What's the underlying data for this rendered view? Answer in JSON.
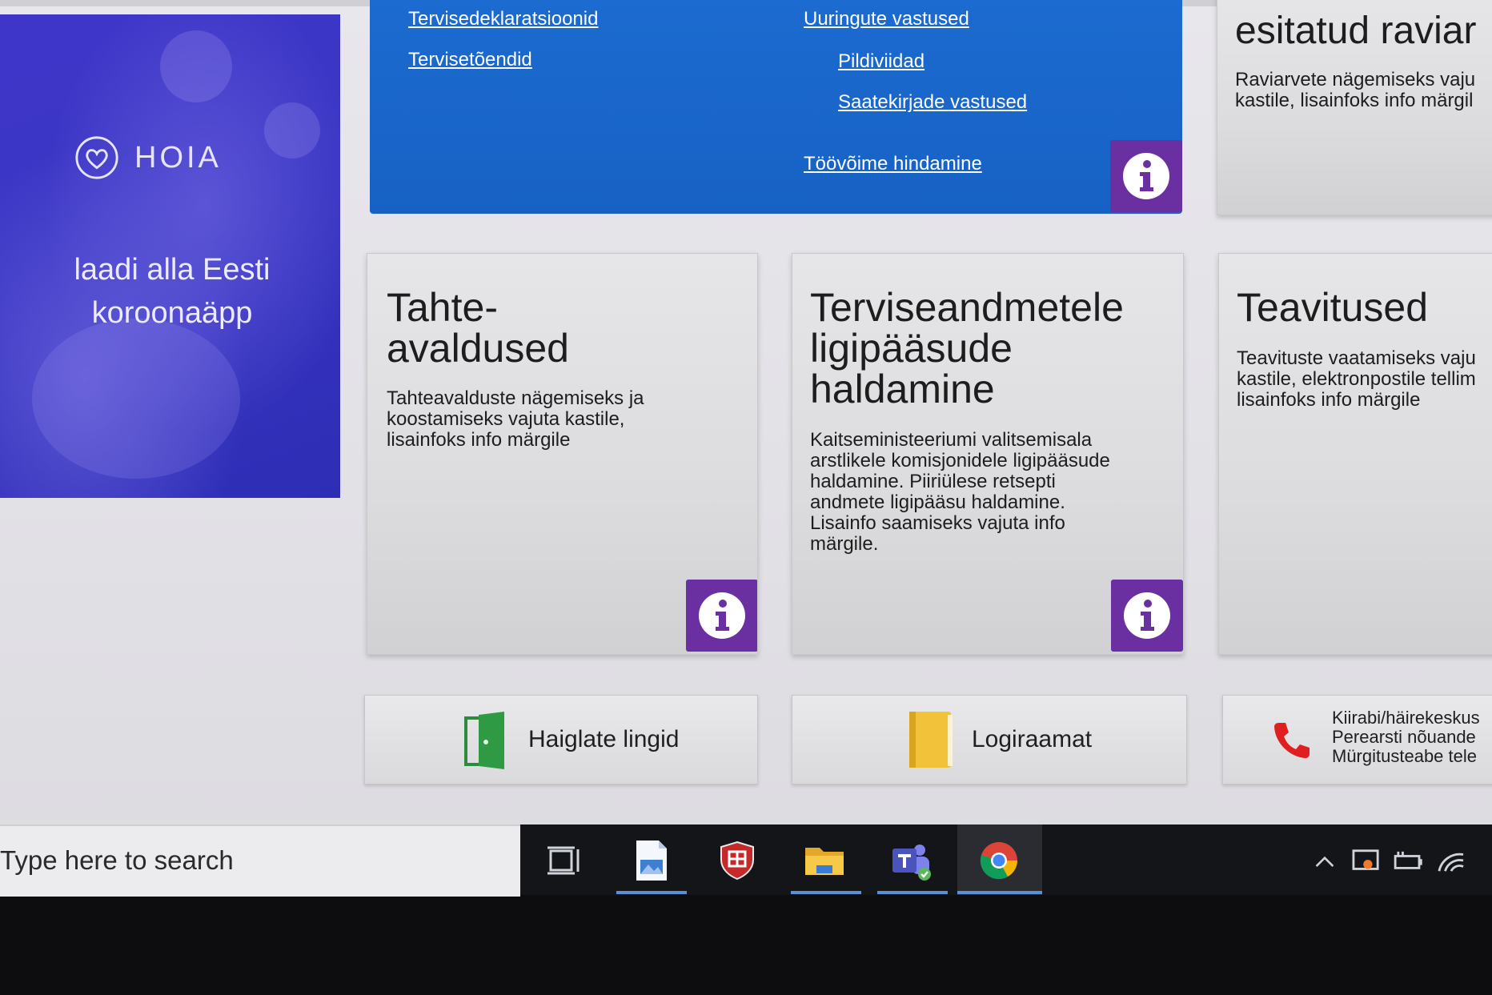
{
  "hoia": {
    "logo_text": "HOIA",
    "tagline_line1": "laadi alla Eesti",
    "tagline_line2": "koroonaäpp"
  },
  "blue_card": {
    "links_left": [
      "Tervisedeklaratsioonid",
      "Tervisetõendid"
    ],
    "links_right": [
      "Uuringute vastused",
      "Pildiviidad",
      "Saatekirjade vastused",
      "Töövõime hindamine"
    ]
  },
  "right_top_card": {
    "title": "esitatud raviar",
    "desc_line1": "Raviarvete nägemiseks vaju",
    "desc_line2": "kastile, lisainfoks info märgil"
  },
  "cards": {
    "tahteavaldused": {
      "title_line1": "Tahte-",
      "title_line2": "avaldused",
      "desc": [
        "Tahteavalduste nägemiseks ja",
        "koostamiseks vajuta kastile,",
        "lisainfoks info märgile"
      ]
    },
    "terviseandmed": {
      "title_line1": "Terviseandmetele",
      "title_line2": "ligipääsude",
      "title_line3": "haldamine",
      "desc": [
        "Kaitseministeeriumi valitsemisala",
        "arstlikele komisjonidele ligipääsude",
        "haldamine. Piiriülese retsepti",
        "andmete ligipääsu haldamine.",
        "Lisainfo saamiseks vajuta info",
        "märgile."
      ]
    },
    "teavitused": {
      "title": "Teavitused",
      "desc": [
        "Teavituste vaatamiseks vaju",
        "kastile, elektronpostile tellim",
        "lisainfoks info märgile"
      ]
    }
  },
  "buttons": {
    "haiglate": "Haiglate lingid",
    "logiraamat": "Logiraamat",
    "phone_lines": [
      "Kiirabi/häirekeskus",
      "Perearsti nõuande",
      "Mürgitusteabe tele"
    ]
  },
  "taskbar": {
    "search_placeholder": "Type here to search"
  },
  "colors": {
    "blue_card": "#1761c4",
    "info_purple": "#6a2fa0",
    "hoia_bg": "#3a36c4",
    "taskbar": "#141518"
  }
}
